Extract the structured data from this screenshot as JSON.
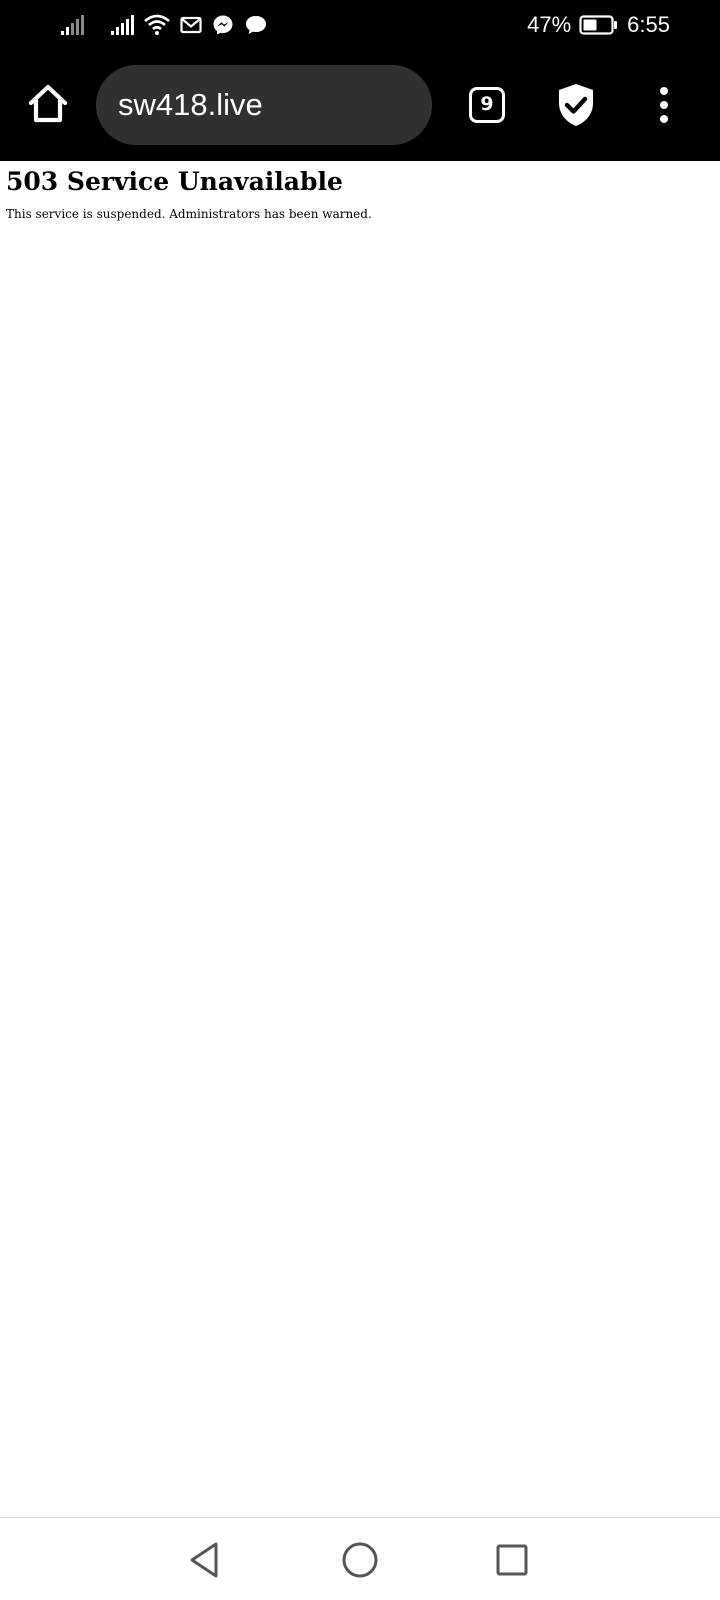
{
  "status_bar": {
    "icons": [
      "signal-sim1-icon",
      "signal-sim2-icon",
      "wifi-icon",
      "gmail-icon",
      "messenger-icon",
      "messages-icon"
    ],
    "battery_percent": "47%",
    "time": "6:55"
  },
  "browser": {
    "url": "sw418.live",
    "tab_count": "9",
    "icons": [
      "home-icon",
      "tab-switcher-icon",
      "shield-check-icon",
      "more-vert-icon"
    ]
  },
  "page": {
    "heading": "503 Service Unavailable",
    "message": "This service is suspended. Administrators has been warned."
  },
  "nav_bar": {
    "icons": [
      "back-icon",
      "home-circle-icon",
      "recents-icon"
    ]
  }
}
